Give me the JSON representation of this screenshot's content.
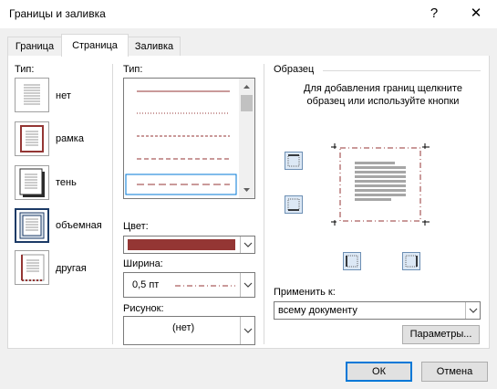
{
  "window": {
    "title": "Границы и заливка",
    "help": "?",
    "close": "✕"
  },
  "tabs": [
    {
      "label": "Граница",
      "active": false
    },
    {
      "label": "Страница",
      "active": true
    },
    {
      "label": "Заливка",
      "active": false
    }
  ],
  "settings": {
    "label": "Тип:",
    "items": [
      {
        "label": "нет",
        "icon": "setting-none-icon"
      },
      {
        "label": "рамка",
        "icon": "setting-box-icon"
      },
      {
        "label": "тень",
        "icon": "setting-shadow-icon"
      },
      {
        "label": "объемная",
        "icon": "setting-3d-icon",
        "selected": true
      },
      {
        "label": "другая",
        "icon": "setting-custom-icon"
      }
    ]
  },
  "style": {
    "label": "Тип:",
    "line_styles": [
      "solid",
      "dotted",
      "dash-small",
      "dash-medium",
      "dash-large"
    ],
    "selected_index": 4
  },
  "color": {
    "label": "Цвет:",
    "value_hex": "#943634"
  },
  "width": {
    "label": "Ширина:",
    "value": "0,5 пт"
  },
  "art": {
    "label": "Рисунок:",
    "value": "(нет)"
  },
  "preview": {
    "label": "Образец",
    "hint": "Для добавления границ щелкните образец или используйте кнопки"
  },
  "apply": {
    "label": "Применить к:",
    "value": "всему документу"
  },
  "buttons": {
    "options": "Параметры...",
    "ok": "ОК",
    "cancel": "Отмена"
  },
  "colors": {
    "accent": "#0078d7",
    "border_line": "#943634"
  }
}
